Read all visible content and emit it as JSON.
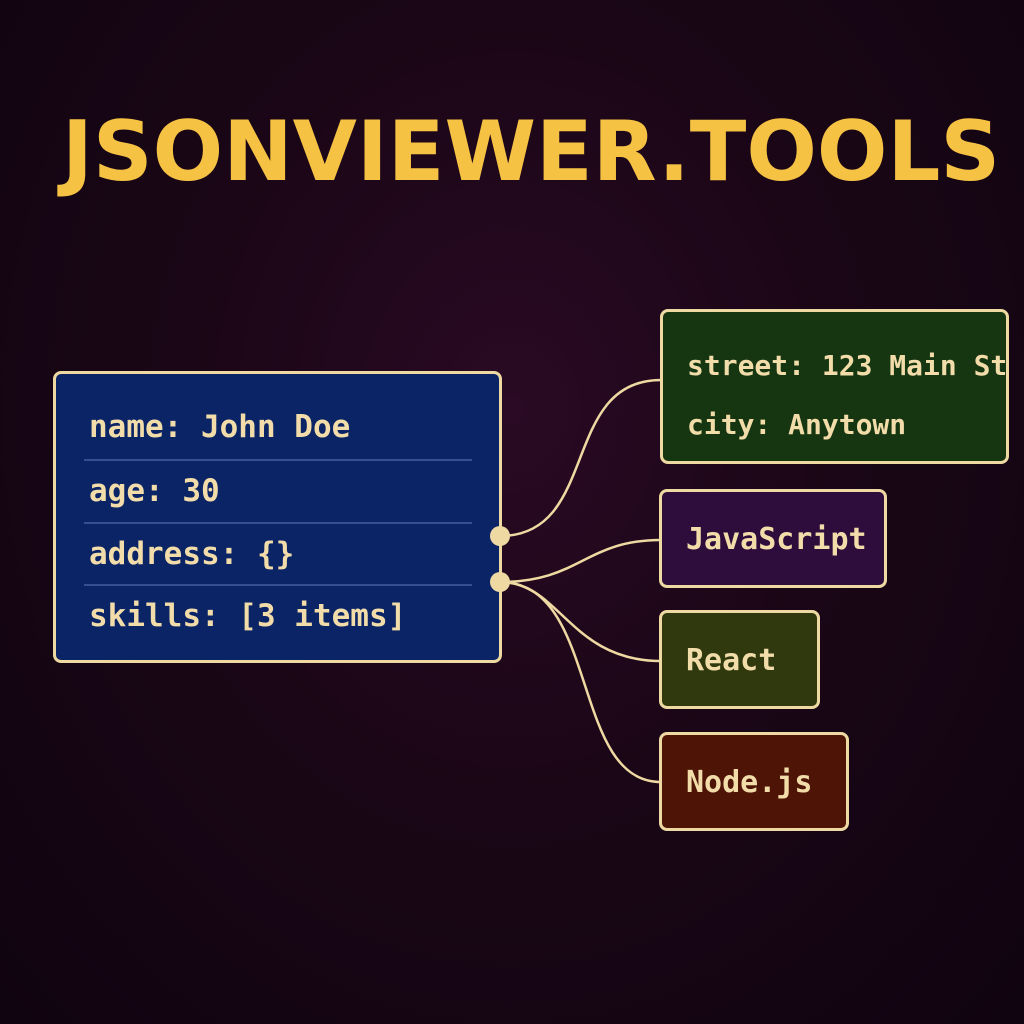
{
  "title": "JSONVIEWER.TOOLS",
  "root_node": {
    "rows": [
      "name: John Doe",
      "age: 30",
      "address: {}",
      "skills: [3 items]"
    ]
  },
  "address_node": {
    "street": "street: 123 Main St",
    "city": "city: Anytown"
  },
  "skills_nodes": [
    {
      "label": "JavaScript"
    },
    {
      "label": "React"
    },
    {
      "label": "Node.js"
    }
  ],
  "colors": {
    "background": "#1a0616",
    "title": "#f6c244",
    "root_fill": "#0b2466",
    "address_fill": "#163611",
    "javascript_fill": "#2e0d3c",
    "react_fill": "#2f390d",
    "node_fill": "#4e1406",
    "border_and_text": "#efd9a2"
  }
}
